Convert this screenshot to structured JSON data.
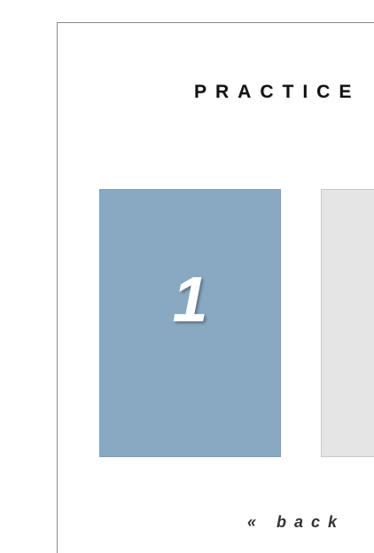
{
  "page": {
    "title": "PRACTICE"
  },
  "cards": [
    {
      "number": "1",
      "color": "#89a9c3"
    },
    {
      "number": "",
      "color": "#e5e5e5"
    }
  ],
  "nav": {
    "back_label": "« back"
  }
}
